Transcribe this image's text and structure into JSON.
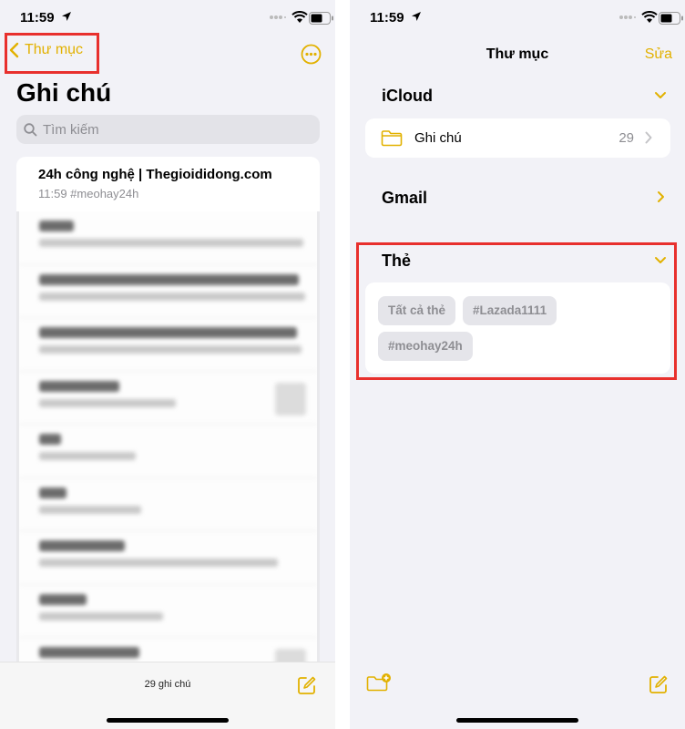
{
  "left": {
    "status_time": "11:59",
    "back_label": "Thư mục",
    "title": "Ghi chú",
    "search_placeholder": "Tìm kiếm",
    "pinned_note": {
      "title": "24h công nghệ | Thegioididong.com",
      "subtitle": "11:59  #meohay24h"
    },
    "note_count": "29 ghi chú",
    "icons": [
      "chevron-left-icon",
      "more-icon",
      "search-icon",
      "compose-icon"
    ]
  },
  "right": {
    "status_time": "11:59",
    "nav_title": "Thư mục",
    "edit_label": "Sửa",
    "sections": {
      "icloud": "iCloud",
      "gmail": "Gmail",
      "tags": "Thẻ"
    },
    "folder": {
      "name": "Ghi chú",
      "count": "29"
    },
    "tags": [
      "Tất cả thẻ",
      "#Lazada1111",
      "#meohay24h"
    ],
    "icons": [
      "chevron-down-icon",
      "chevron-right-icon",
      "folder-icon",
      "new-folder-icon",
      "compose-icon"
    ]
  },
  "colors": {
    "accent": "#e2b100",
    "highlight": "#e8302d",
    "background": "#f2f2f7"
  }
}
